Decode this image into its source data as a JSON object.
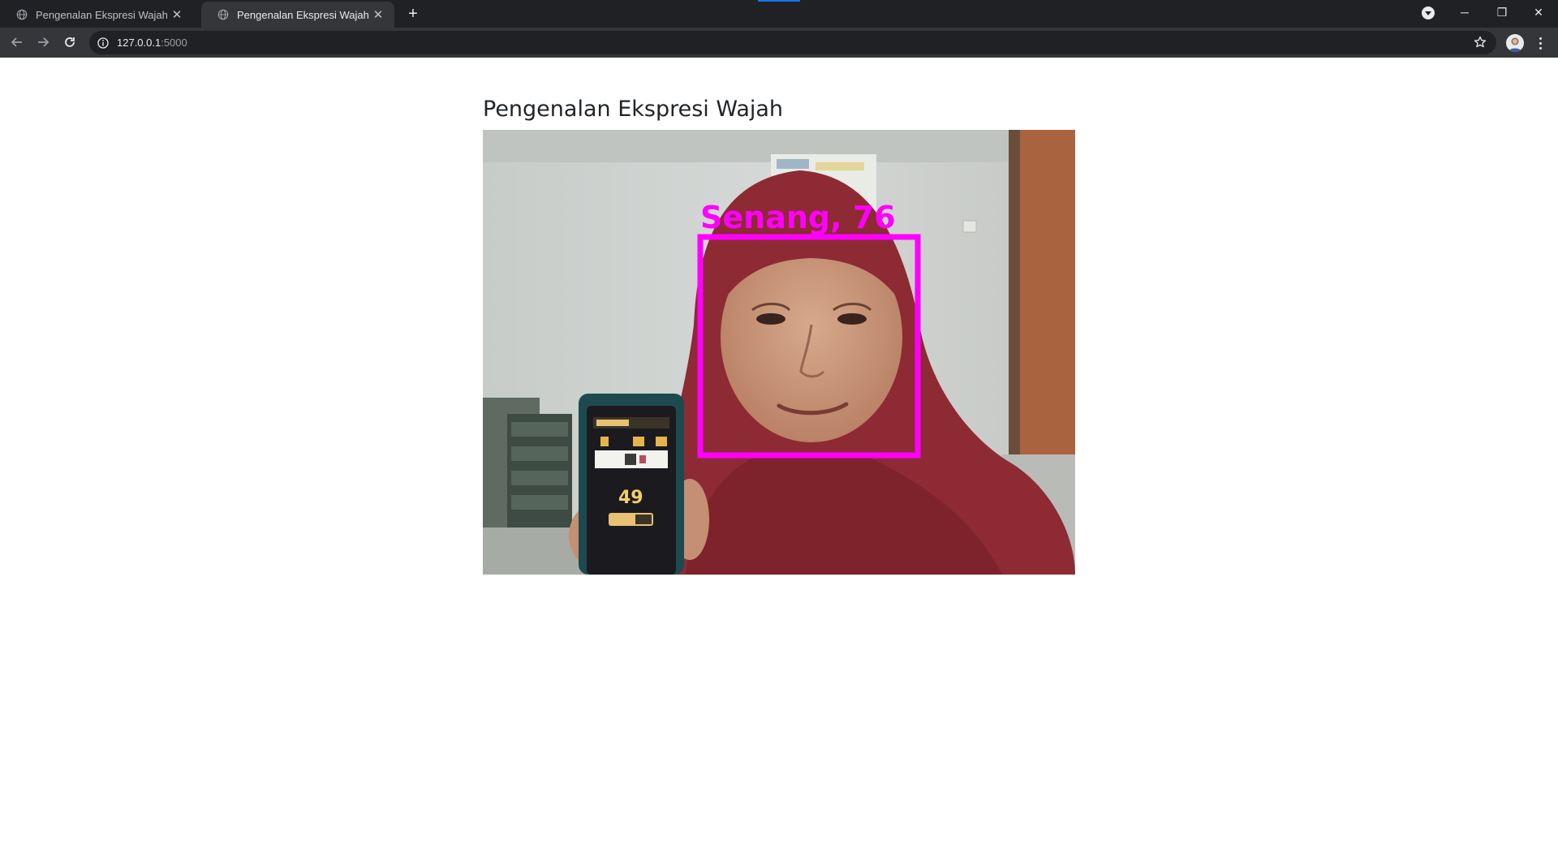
{
  "browser": {
    "tabs": [
      {
        "title": "Pengenalan Ekspresi Wajah",
        "active": false
      },
      {
        "title": "Pengenalan Ekspresi Wajah",
        "active": true
      }
    ],
    "new_tab_label": "+",
    "window_controls": {
      "minimize": "─",
      "restore": "❐",
      "close": "✕"
    },
    "address": {
      "host": "127.0.0.1",
      "port": ":5000"
    },
    "icons": [
      "globe-icon",
      "close-icon",
      "plus-icon",
      "back-icon",
      "forward-icon",
      "reload-icon",
      "info-icon",
      "star-icon",
      "avatar-icon",
      "more-icon"
    ]
  },
  "page": {
    "title": "Pengenalan Ekspresi Wajah",
    "video_feed": {
      "detection_label": "Senang, 76",
      "box_color": "#ff00ff",
      "phone_screen_number": "49"
    }
  }
}
